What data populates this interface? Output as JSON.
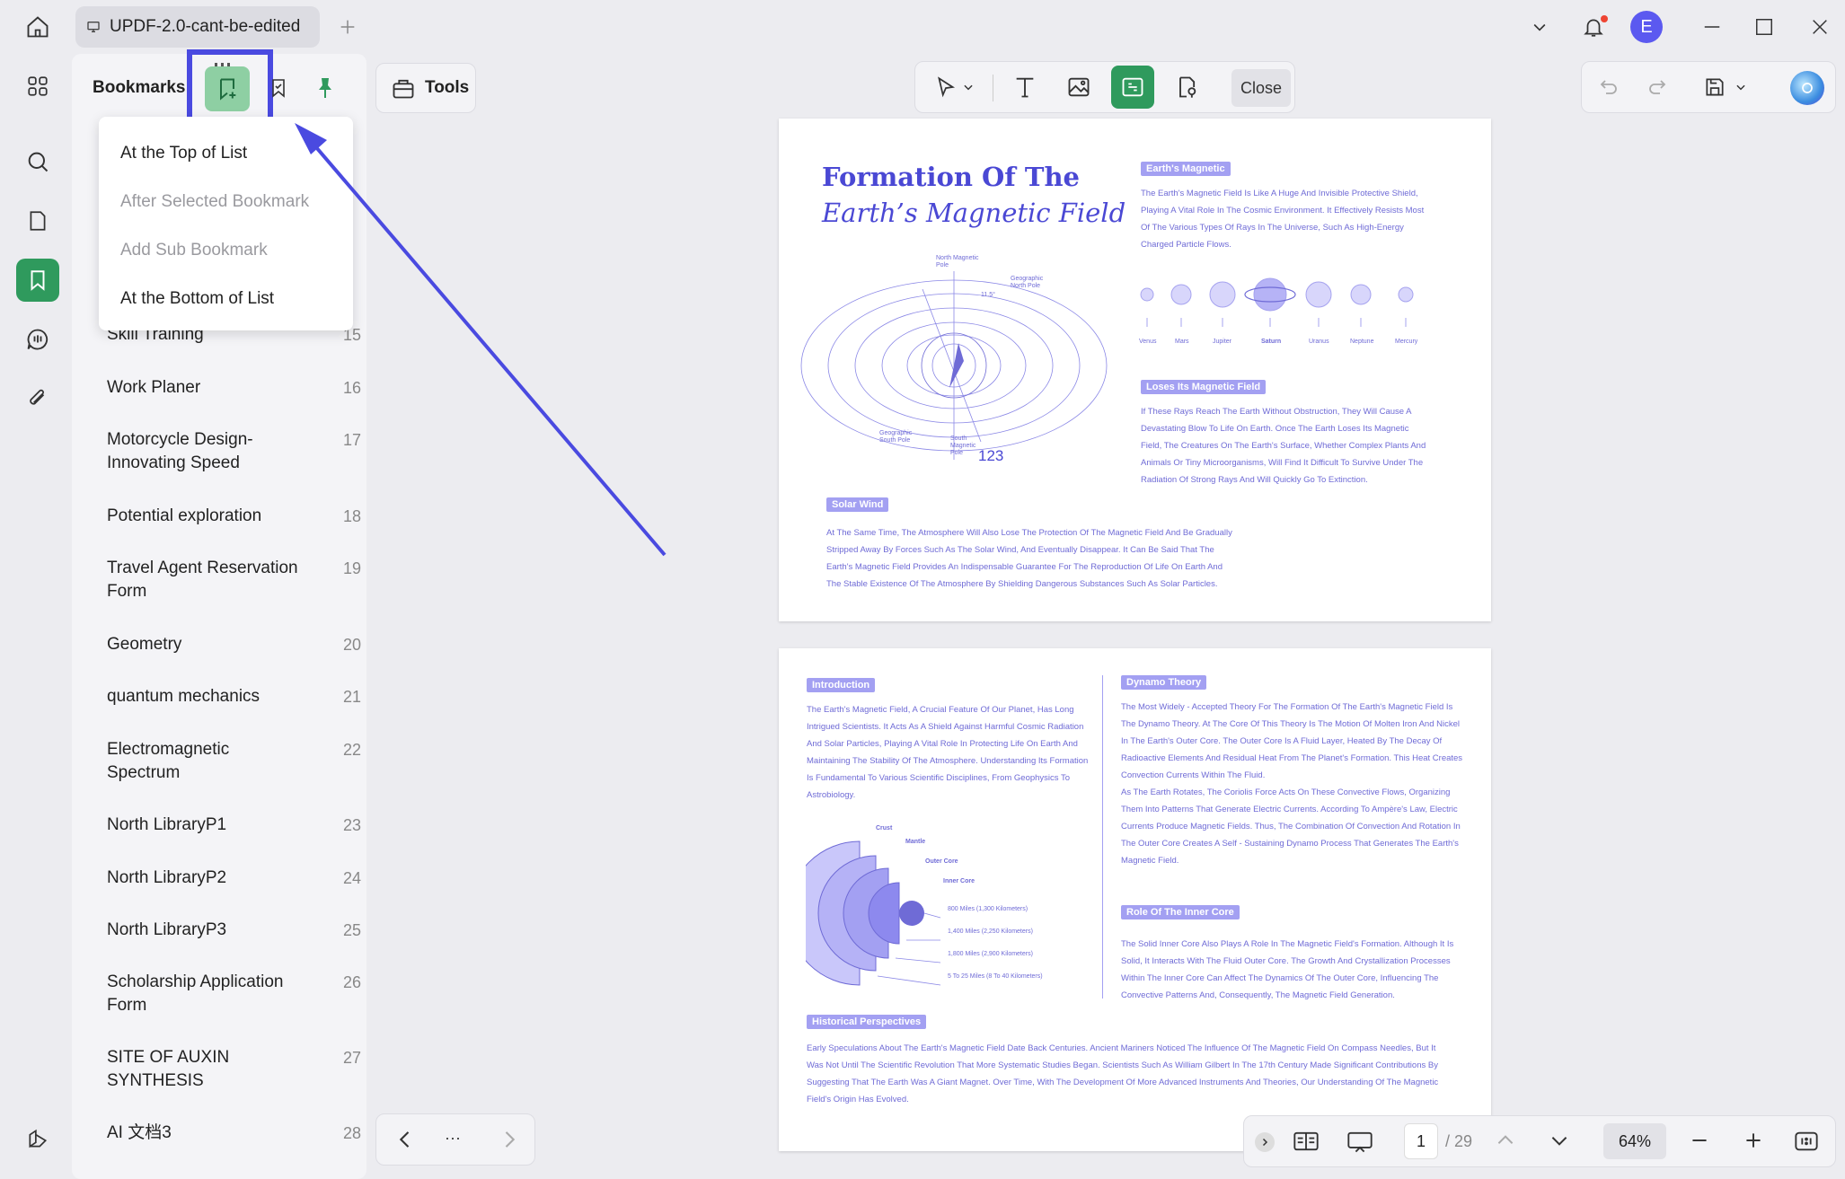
{
  "tab": {
    "title": "UPDF-2.0-cant-be-edited"
  },
  "user": {
    "initial": "E"
  },
  "panel": {
    "title": "Bookmarks",
    "items": [
      {
        "label": "Skill Training",
        "page": "15"
      },
      {
        "label": "Work Planer",
        "page": "16"
      },
      {
        "label": "Motorcycle Design-Innovating Speed",
        "page": "17"
      },
      {
        "label": "Potential exploration",
        "page": "18"
      },
      {
        "label": "Travel Agent Reservation Form",
        "page": "19"
      },
      {
        "label": "Geometry",
        "page": "20"
      },
      {
        "label": "quantum mechanics",
        "page": "21"
      },
      {
        "label": "Electromagnetic Spectrum",
        "page": "22"
      },
      {
        "label": "North LibraryP1",
        "page": "23"
      },
      {
        "label": "North LibraryP2",
        "page": "24"
      },
      {
        "label": "North LibraryP3",
        "page": "25"
      },
      {
        "label": "Scholarship Application Form",
        "page": "26"
      },
      {
        "label": "SITE OF AUXIN SYNTHESIS",
        "page": "27"
      },
      {
        "label": "AI 文档3",
        "page": "28"
      }
    ]
  },
  "dropdown": {
    "top": "At the Top of List",
    "after": "After Selected Bookmark",
    "sub": "Add Sub Bookmark",
    "bottom": "At the Bottom of List"
  },
  "toolbar": {
    "tools_label": "Tools",
    "close_label": "Close"
  },
  "page1": {
    "title_line1": "Formation Of The",
    "title_line2": "Earth’s Magnetic Field",
    "label_magnetic": "Earth's Magnetic",
    "text_magnetic": [
      "The Earth's Magnetic Field Is Like A Huge And Invisible Protective Shield,",
      "Playing A Vital Role In The Cosmic Environment. It Effectively Resists Most",
      "Of The Various Types Of Rays In The Universe, Such As High-Energy",
      "Charged Particle Flows."
    ],
    "planets": [
      "Venus",
      "Mars",
      "Jupiter",
      "Saturn",
      "Uranus",
      "Neptune",
      "Mercury"
    ],
    "label_loses": "Loses Its Magnetic Field",
    "text_loses": [
      "If These Rays Reach The Earth Without Obstruction, They Will Cause A",
      "Devastating Blow To Life On Earth. Once The Earth Loses Its Magnetic",
      "Field, The Creatures On The Earth's Surface, Whether Complex Plants And",
      "Animals Or Tiny Microorganisms, Will Find It Difficult To Survive Under The",
      "Radiation Of Strong Rays And Will Quickly Go To Extinction."
    ],
    "diagram": {
      "north_mag": "North Magnetic Pole",
      "geo_north": "Geographic North Pole",
      "geo_south": "Geographic South Pole",
      "south_mag": "South Magnetic Pole",
      "angle": "11.5°",
      "number": "123"
    },
    "label_solar": "Solar Wind",
    "text_solar": [
      "At The Same Time, The Atmosphere Will Also Lose The Protection Of The Magnetic Field And Be Gradually",
      "Stripped Away By Forces Such As The Solar Wind, And Eventually Disappear. It Can Be Said That The",
      "Earth's Magnetic Field Provides An Indispensable Guarantee For The Reproduction Of Life On Earth And",
      "The Stable Existence Of The Atmosphere By Shielding Dangerous Substances Such As Solar Particles."
    ]
  },
  "page2": {
    "label_intro": "Introduction",
    "text_intro": [
      "The Earth's Magnetic Field, A Crucial Feature Of Our Planet, Has Long",
      "Intrigued Scientists. It Acts As A Shield Against Harmful Cosmic Radiation",
      "And Solar Particles, Playing A Vital Role In Protecting Life On Earth And",
      "Maintaining The Stability Of The Atmosphere. Understanding Its Formation",
      "Is Fundamental To Various Scientific Disciplines, From Geophysics To",
      "Astrobiology."
    ],
    "layers": [
      "Crust",
      "Mantle",
      "Outer Core",
      "Inner Core"
    ],
    "depths": [
      "800 Miles (1,300 Kilometers)",
      "1,400 Miles (2,250 Kilometers)",
      "1,800 Miles (2,900 Kilometers)",
      "5 To 25 Miles (8 To 40 Kilometers)"
    ],
    "label_dynamo": "Dynamo Theory",
    "text_dynamo": [
      "The Most Widely - Accepted Theory For The Formation Of The Earth's Magnetic Field Is",
      "The Dynamo Theory. At The Core Of This Theory Is The Motion Of Molten Iron And Nickel",
      "In The Earth's Outer Core. The Outer Core Is A Fluid Layer, Heated By The Decay Of",
      "Radioactive Elements And Residual Heat From The Planet's Formation. This Heat Creates",
      "Convection Currents Within The Fluid.",
      "As The Earth Rotates, The Coriolis Force Acts On These Convective Flows, Organizing",
      "Them Into Patterns That Generate Electric Currents. According To Ampère's Law, Electric",
      "Currents Produce Magnetic Fields. Thus, The Combination Of Convection And Rotation In",
      "The Outer Core Creates A Self - Sustaining Dynamo Process That Generates The Earth's",
      "Magnetic Field."
    ],
    "label_role": "Role Of The Inner Core",
    "text_role": [
      "The Solid Inner Core Also Plays A Role In The Magnetic Field's Formation. Although It Is",
      "Solid, It Interacts With The Fluid Outer Core. The Growth And Crystallization Processes",
      "Within The Inner Core Can Affect The Dynamics Of The Outer Core, Influencing The",
      "Convective Patterns And, Consequently, The Magnetic Field Generation."
    ],
    "label_history": "Historical Perspectives",
    "text_history": [
      "Early Speculations About The Earth's Magnetic Field Date Back Centuries. Ancient Mariners Noticed The Influence Of The Magnetic Field On Compass Needles, But It",
      "Was Not Until The Scientific Revolution That More Systematic Studies Began. Scientists Such As William Gilbert In The 17th Century Made Significant Contributions By",
      "Suggesting That The Earth Was A Giant Magnet. Over Time, With The Development Of More Advanced Instruments And Theories, Our Understanding Of The Magnetic",
      "Field's Origin Has Evolved."
    ]
  },
  "pager": {
    "current": "1",
    "total": "/ 29",
    "zoom": "64%",
    "ellipsis": "···"
  },
  "colors": {
    "accent": "#2f9a5d",
    "highlight": "#4a4ae0",
    "doc_text": "#6f6bd6",
    "doc_label": "#a3a0f2"
  }
}
